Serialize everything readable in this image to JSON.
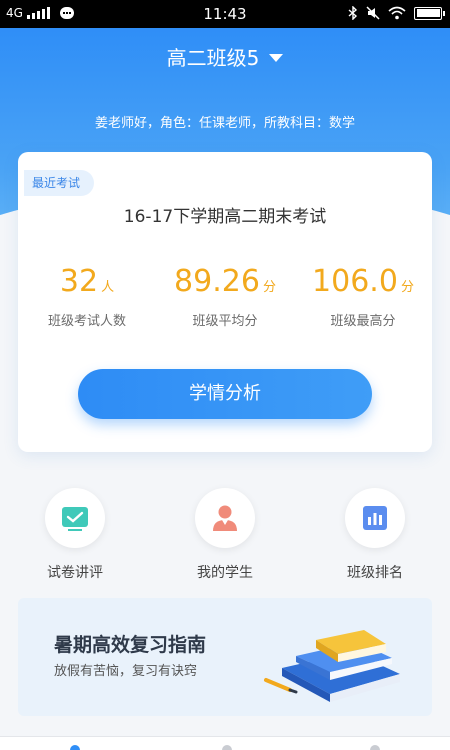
{
  "statusbar": {
    "network": "4G",
    "time": "11:43"
  },
  "header": {
    "class_name": "高二班级5",
    "greeting": "姜老师好，角色：任课老师，所教科目：数学"
  },
  "exam_card": {
    "tag": "最近考试",
    "exam_name": "16-17下学期高二期末考试",
    "stats": [
      {
        "value": "32",
        "unit": "人",
        "label": "班级考试人数"
      },
      {
        "value": "89.26",
        "unit": "分",
        "label": "班级平均分"
      },
      {
        "value": "106.0",
        "unit": "分",
        "label": "班级最高分"
      }
    ],
    "button_label": "学情分析"
  },
  "actions": [
    {
      "label": "试卷讲评",
      "icon": "paper-review-icon"
    },
    {
      "label": "我的学生",
      "icon": "student-icon"
    },
    {
      "label": "班级排名",
      "icon": "ranking-chart-icon"
    }
  ],
  "banner": {
    "title": "暑期高效复习指南",
    "subtitle": "放假有苦恼，复习有诀窍"
  },
  "colors": {
    "primary": "#2f8ef7",
    "accent": "#f2a91d"
  }
}
